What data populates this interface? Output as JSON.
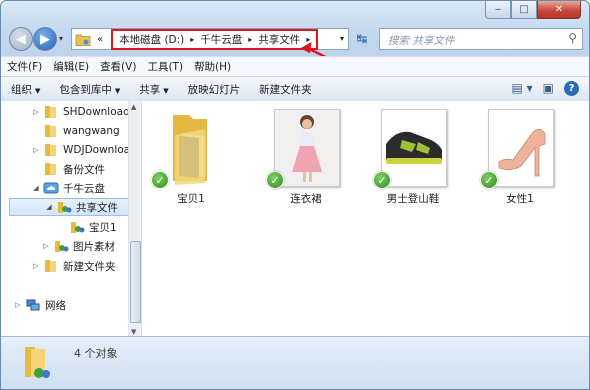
{
  "window": {
    "caption": {
      "minimize": "‒",
      "maximize": "□",
      "close": "✕"
    }
  },
  "nav": {
    "back_icon": "back-arrow-icon",
    "forward_icon": "forward-arrow-icon",
    "recent_glyph": "▾",
    "address": {
      "chevron": "«",
      "crumbs": [
        "本地磁盘 (D:)",
        "千牛云盘",
        "共享文件"
      ],
      "sep": "▸",
      "dropdown": "▾"
    },
    "refresh_glyph": "↹",
    "search_placeholder": "搜索 共享文件",
    "search_icon": "search-icon"
  },
  "menu": [
    "文件(F)",
    "编辑(E)",
    "查看(V)",
    "工具(T)",
    "帮助(H)"
  ],
  "commands": [
    {
      "label": "组织",
      "dropdown": true
    },
    {
      "label": "包含到库中",
      "dropdown": true
    },
    {
      "label": "共享",
      "dropdown": true
    },
    {
      "label": "放映幻灯片",
      "dropdown": false
    },
    {
      "label": "新建文件夹",
      "dropdown": false
    }
  ],
  "tree": [
    {
      "label": "SHDownload",
      "indent": 1,
      "expander": "▷",
      "icon": "folder"
    },
    {
      "label": "wangwang",
      "indent": 1,
      "expander": "",
      "icon": "folder"
    },
    {
      "label": "WDJDownload",
      "indent": 1,
      "expander": "▷",
      "icon": "folder"
    },
    {
      "label": "备份文件",
      "indent": 1,
      "expander": "",
      "icon": "folder"
    },
    {
      "label": "千牛云盘",
      "indent": 1,
      "expander": "◢",
      "icon": "cloud"
    },
    {
      "label": "共享文件",
      "indent": 2,
      "expander": "◢",
      "icon": "shared",
      "selected": true
    },
    {
      "label": "宝贝1",
      "indent": 3,
      "expander": "",
      "icon": "shared-small"
    },
    {
      "label": "图片素材",
      "indent": 2,
      "expander": "▷",
      "icon": "shared"
    },
    {
      "label": "新建文件夹",
      "indent": 1,
      "expander": "▷",
      "icon": "folder"
    },
    {
      "label": "网络",
      "indent": 0,
      "expander": "▷",
      "icon": "network"
    }
  ],
  "files": [
    {
      "label": "宝贝1",
      "kind": "folder"
    },
    {
      "label": "连衣裙",
      "kind": "dress"
    },
    {
      "label": "男士登山鞋",
      "kind": "shoe"
    },
    {
      "label": "女性1",
      "kind": "heel"
    }
  ],
  "status": {
    "count": "4 个对象"
  },
  "colors": {
    "highlight": "#e0161d",
    "accent": "#2a6ab8"
  }
}
